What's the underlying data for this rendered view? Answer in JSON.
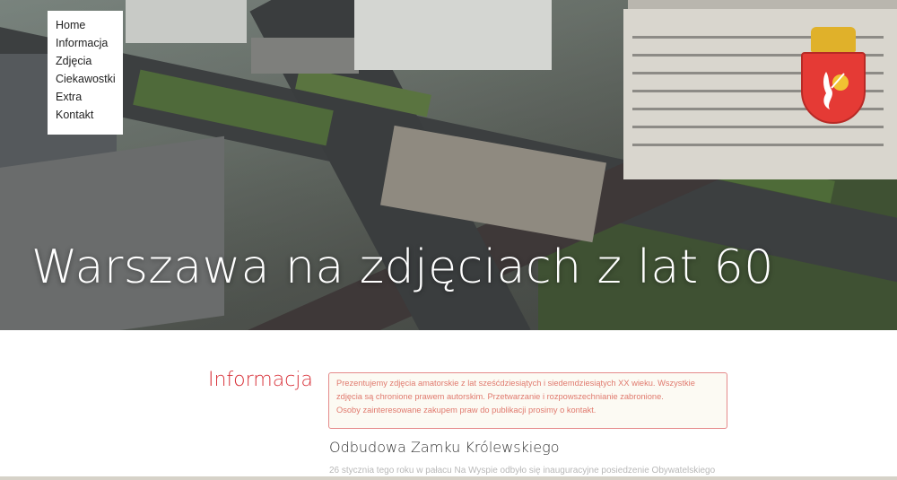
{
  "nav": {
    "items": [
      "Home",
      "Informacja",
      "Zdjęcia",
      "Ciekawostki",
      "Extra",
      "Kontakt"
    ]
  },
  "hero": {
    "title": "Warszawa na zdjęciach z lat 60",
    "crest_icon": "warsaw-mermaid-coat-of-arms"
  },
  "info": {
    "heading": "Informacja",
    "notice_lines": [
      "Prezentujemy zdjęcia amatorskie z lat sześćdziesiątych i siedemdziesiątych XX wieku. Wszystkie",
      "zdjęcia są chronione prawem autorskim. Przetwarzanie i rozpowszechnianie zabronione.",
      "Osoby zainteresowane zakupem praw do publikacji prosimy o kontakt."
    ]
  },
  "article": {
    "title": "Odbudowa Zamku Królewskiego",
    "text": "26 stycznia tego roku w pałacu Na Wyspie odbyło się inauguracyjne posiedzenie Obywatelskiego"
  },
  "colors": {
    "accent": "#d8323a",
    "notice_border": "#e58a8a",
    "notice_text": "#e07a6e"
  }
}
